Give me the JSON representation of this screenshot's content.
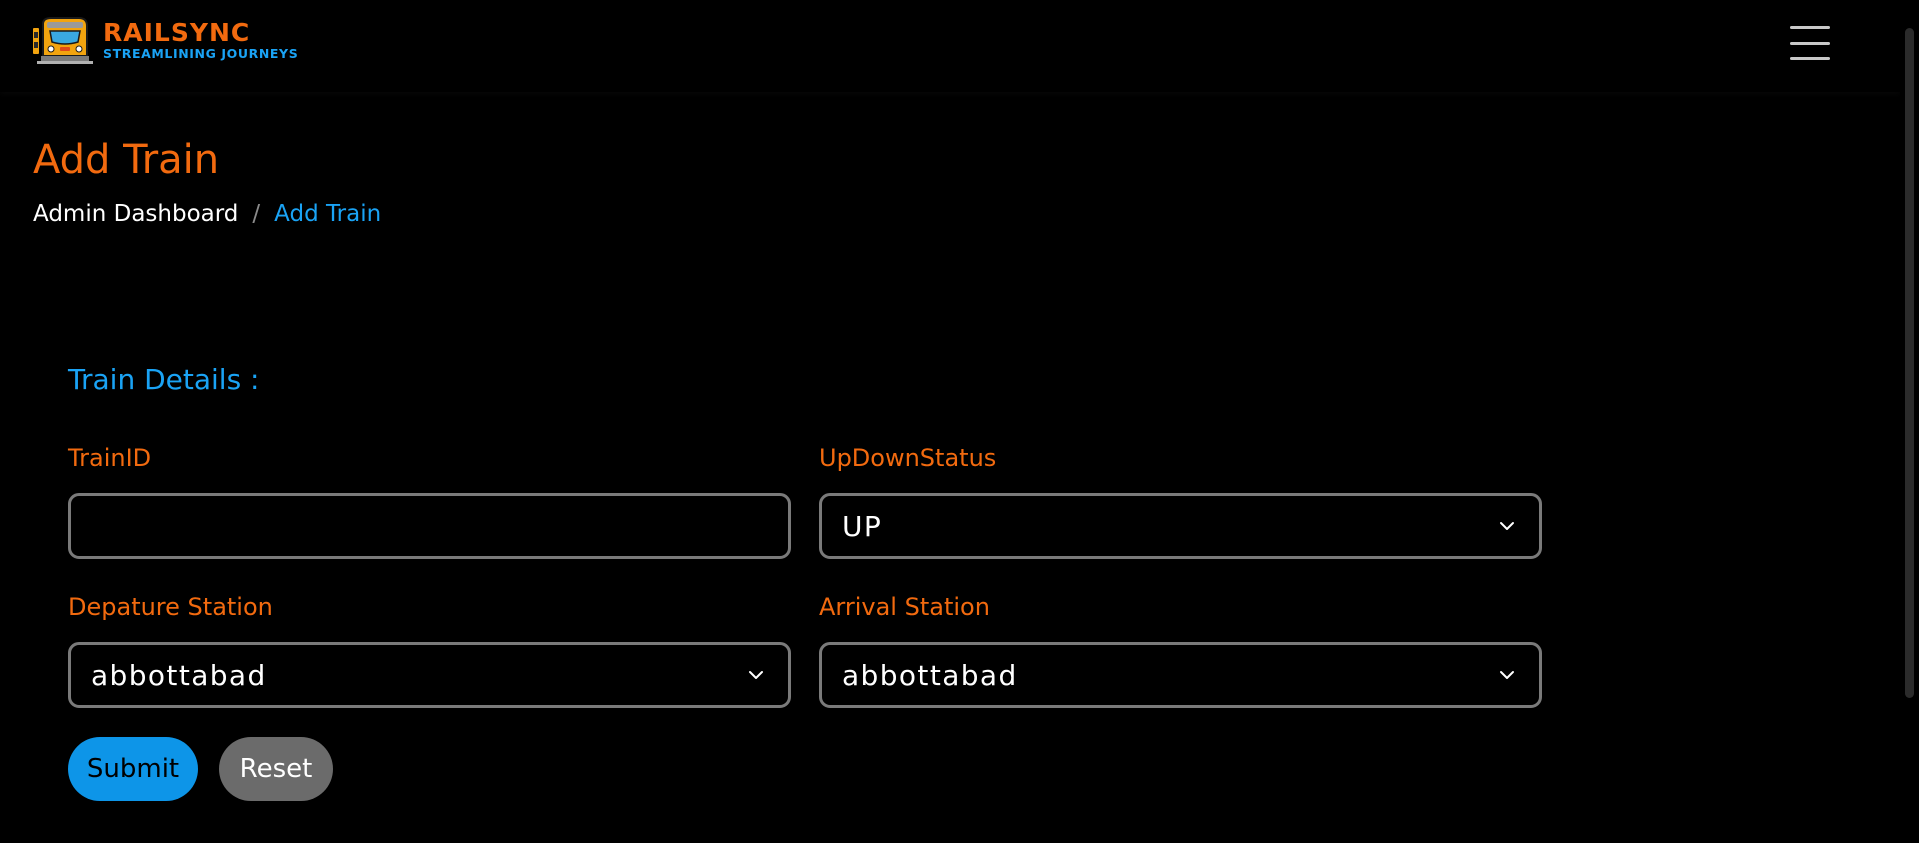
{
  "colors": {
    "accent_orange": "#f26a0f",
    "accent_blue": "#1aa3f5",
    "submit_bg": "#0d95e8",
    "reset_bg": "#6b6b6b"
  },
  "header": {
    "logo_title": "RAILSYNC",
    "logo_subtitle": "STREAMLINING JOURNEYS",
    "menu_icon": "hamburger-menu-icon"
  },
  "page": {
    "title": "Add Train",
    "breadcrumb": [
      {
        "label": "Admin Dashboard"
      },
      {
        "label": "/"
      },
      {
        "label": "Add Train"
      }
    ]
  },
  "form": {
    "section_title": "Train Details :",
    "fields": {
      "train_id": {
        "label": "TrainID",
        "value": "",
        "placeholder": ""
      },
      "up_down_status": {
        "label": "UpDownStatus",
        "value": "UP"
      },
      "departure_station": {
        "label": "Depature Station",
        "value": "abbottabad"
      },
      "arrival_station": {
        "label": "Arrival Station",
        "value": "abbottabad"
      }
    },
    "buttons": {
      "submit_label": "Submit",
      "reset_label": "Reset"
    }
  }
}
